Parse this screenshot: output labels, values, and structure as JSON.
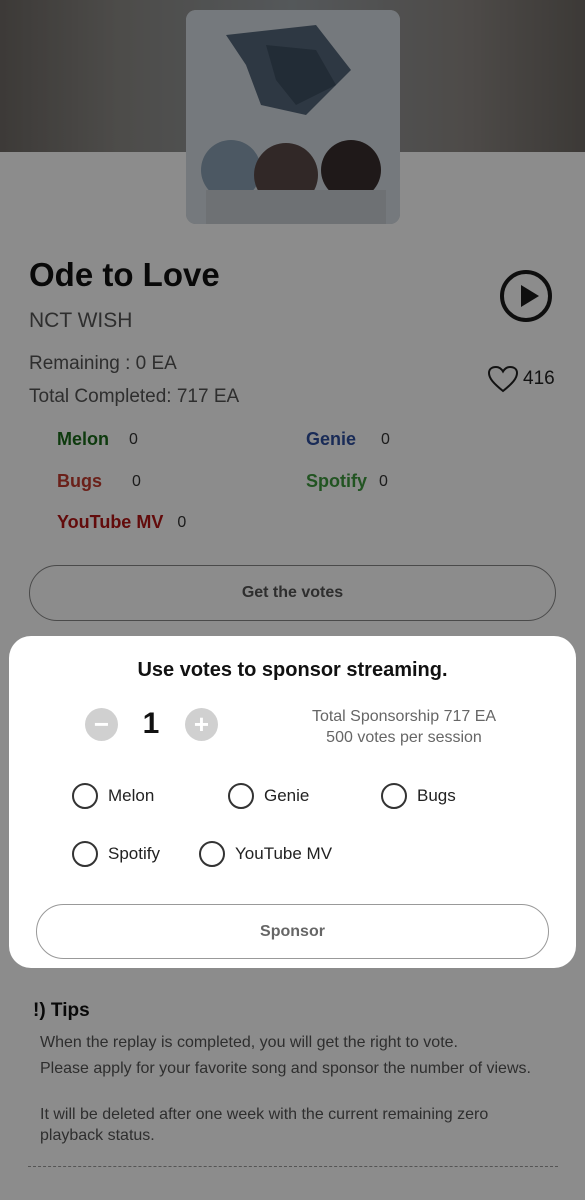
{
  "song": {
    "title": "Ode to Love",
    "artist": "NCT WISH",
    "remaining": "Remaining : 0 EA",
    "total_completed": "Total Completed: 717 EA",
    "likes": "416"
  },
  "platforms": [
    {
      "name": "Melon",
      "count": "0",
      "color": "#1a6b1a"
    },
    {
      "name": "Genie",
      "count": "0",
      "color": "#2f4f9e"
    },
    {
      "name": "Bugs",
      "count": "0",
      "color": "#c23b2e"
    },
    {
      "name": "Spotify",
      "count": "0",
      "color": "#3f9a3f"
    },
    {
      "name": "YouTube MV",
      "count": "0",
      "color": "#b31515"
    }
  ],
  "get_votes_label": "Get the votes",
  "tips": {
    "title": "!) Tips",
    "line1": "When the replay is completed, you will get the right to vote.",
    "line2": "Please apply for your favorite song and sponsor the number of views.",
    "line3": "It will be deleted after one week with the current remaining zero playback status."
  },
  "modal": {
    "title": "Use votes to sponsor streaming.",
    "minus_label": "−",
    "plus_label": "+",
    "quantity": "1",
    "total_sponsorship": "Total Sponsorship 717 EA",
    "votes_per_session": "500 votes per session",
    "options": [
      "Melon",
      "Genie",
      "Bugs",
      "Spotify",
      "YouTube MV"
    ],
    "sponsor_label": "Sponsor"
  },
  "icons": {
    "play": "play-circle-icon",
    "like": "heart-outline-icon"
  }
}
